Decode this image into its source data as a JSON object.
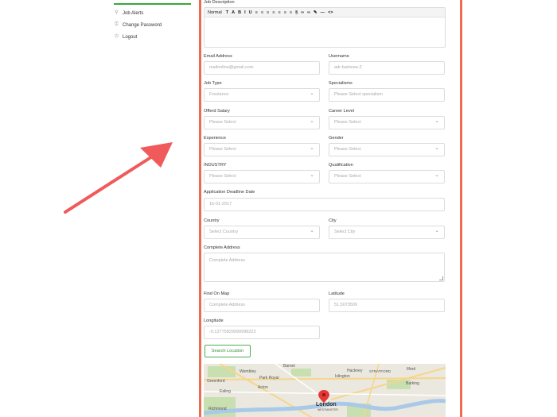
{
  "sidebar": {
    "items": [
      {
        "label": "Job Alerts",
        "icon": "bell-icon"
      },
      {
        "label": "Change Password",
        "icon": "lock-icon"
      },
      {
        "label": "Logout",
        "icon": "power-icon"
      }
    ]
  },
  "form": {
    "job_description": {
      "label": "Job Description"
    },
    "toolbar": {
      "format": "Normal",
      "items": [
        "T",
        "A",
        "B",
        "I",
        "U",
        "≡",
        "≡",
        "≡",
        "≡",
        "≡",
        "≡",
        "≡",
        "§",
        "∞",
        "∞",
        "✎",
        "—",
        "<>"
      ]
    },
    "email": {
      "label": "Email Address",
      "placeholder": "mailonline@gmail.com"
    },
    "username": {
      "label": "Username",
      "placeholder": "adr-barbosa-2"
    },
    "job_type": {
      "label": "Job Type",
      "value": "Freelance"
    },
    "specialisms": {
      "label": "Specialisms",
      "placeholder": "Please Select specialism"
    },
    "offered_salary": {
      "label": "Offerd Salary",
      "value": "Please Select"
    },
    "career_level": {
      "label": "Career Level",
      "value": "Please Select"
    },
    "experience": {
      "label": "Experience",
      "value": "Please Select"
    },
    "gender": {
      "label": "Gender",
      "value": "Please Select"
    },
    "industry": {
      "label": "INDUSTRY",
      "value": "Please Select"
    },
    "qualification": {
      "label": "Qualification",
      "value": "Please Select"
    },
    "deadline": {
      "label": "Application Deadline Date",
      "value": "16-01-2017"
    },
    "country": {
      "label": "Country",
      "value": "Select Country"
    },
    "city": {
      "label": "City",
      "value": "Select City"
    },
    "address": {
      "label": "Complete Address",
      "placeholder": "Complete Address"
    },
    "find_on_map": {
      "label": "Find On Map",
      "placeholder": "Complete Address"
    },
    "latitude": {
      "label": "Latitude",
      "value": "51.5073509"
    },
    "longitude": {
      "label": "Longitude",
      "value": "-0.12775829999998223"
    },
    "search_button": "Search Location"
  },
  "map": {
    "labels": [
      "Wembley",
      "Barnet",
      "Greenford",
      "Park Royal",
      "Ealing",
      "Acton",
      "Islington",
      "Hackney",
      "STRATFORD",
      "Ilford",
      "Barking",
      "London",
      "WESTMINSTER",
      "Richmond"
    ],
    "pin_label": "London"
  },
  "colors": {
    "frame": "#ee6c4d",
    "arrow": "#f05a5a",
    "active_line": "#3aa63a",
    "button": "#4caf50"
  }
}
